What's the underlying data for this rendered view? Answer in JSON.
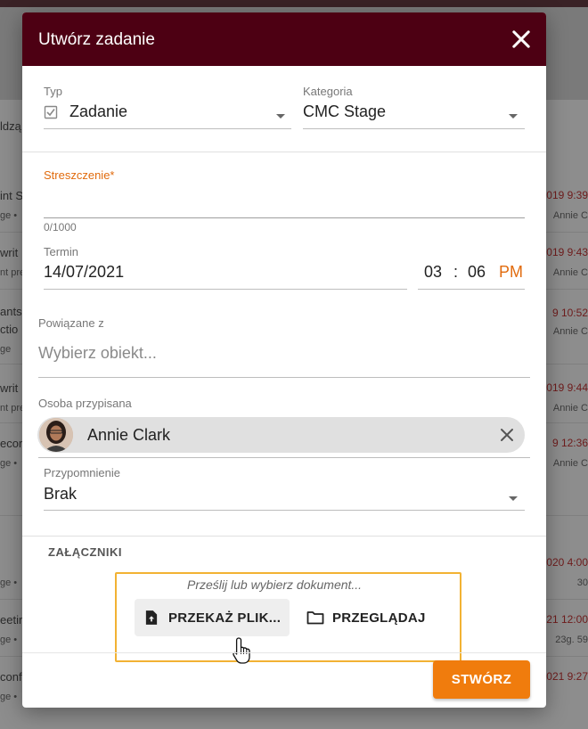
{
  "background": {
    "left_texts": [
      "ldzą",
      "int S",
      "ge  •",
      "writ",
      "nt pre",
      "ants",
      "ctio",
      "ge",
      "writ",
      "nt pre",
      "ecor",
      "ge  •",
      "ge  •",
      "eetir",
      "ge  •",
      "conf",
      "ge  •"
    ],
    "right_texts": [
      "019 9:39",
      "Annie C",
      "019 9:43",
      "Annie C",
      "9 10:52",
      "Annie C",
      "019 9:44",
      "Annie C",
      "9 12:36",
      "Annie C",
      "020 4:00",
      "30",
      "21 12:00",
      "23g. 59",
      "021 9:27"
    ]
  },
  "modal": {
    "title": "Utwórz zadanie",
    "type": {
      "label": "Typ",
      "value": "Zadanie"
    },
    "category": {
      "label": "Kategoria",
      "value": "CMC Stage"
    },
    "summary": {
      "label": "Streszczenie",
      "required_mark": "*",
      "counter": "0/1000"
    },
    "due": {
      "label": "Termin",
      "date": "14/07/2021",
      "hour": "03",
      "separator": ":",
      "minute": "06",
      "ampm": "PM"
    },
    "related": {
      "label": "Powiązane z",
      "placeholder": "Wybierz obiekt..."
    },
    "assignee": {
      "label": "Osoba przypisana",
      "name": "Annie Clark"
    },
    "reminder": {
      "label": "Przypomnienie",
      "value": "Brak"
    },
    "attachments": {
      "title": "ZAŁĄCZNIKI",
      "hint": "Prześlij lub wybierz dokument...",
      "upload_label": "PRZEKAŻ PLIK...",
      "browse_label": "PRZEGLĄDAJ"
    },
    "create_label": "STWÓRZ"
  },
  "colors": {
    "header": "#4d0013",
    "accent": "#f07c0d",
    "required": "#e16b0d",
    "highlight": "#f2b233"
  }
}
